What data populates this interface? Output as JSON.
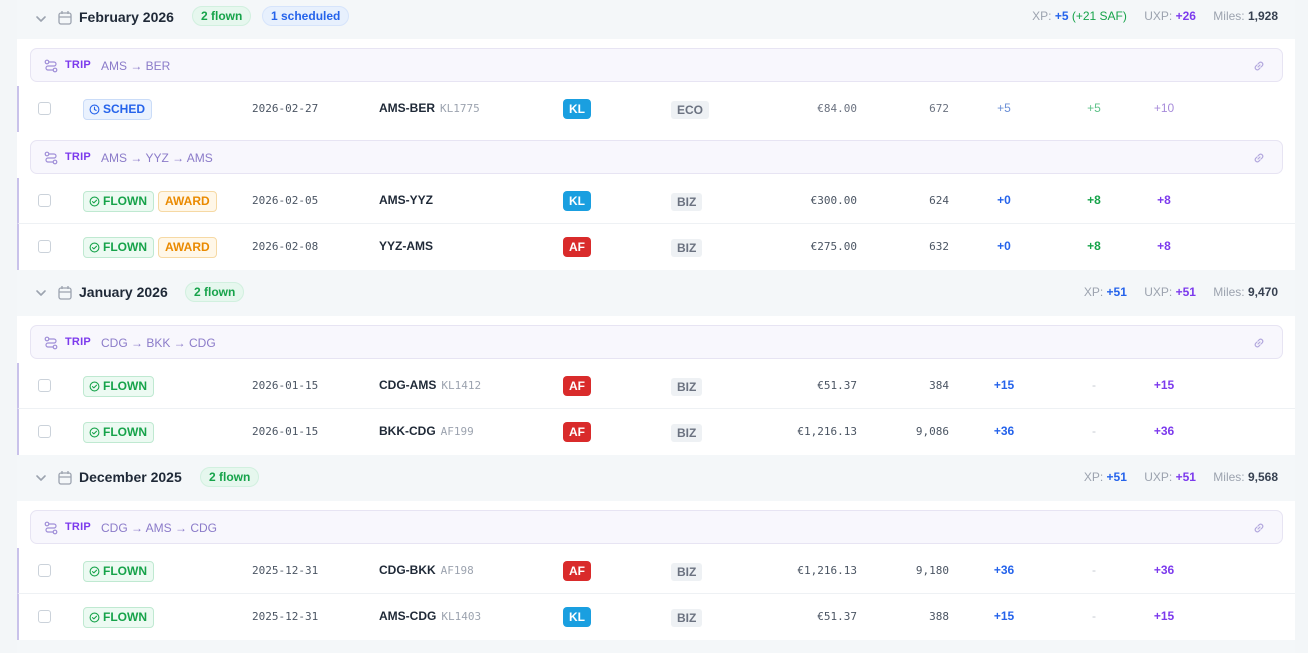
{
  "months": [
    {
      "title": "February 2026",
      "flown_badge": "2 flown",
      "scheduled_badge": "1 scheduled",
      "stats": {
        "xp_label": "XP:",
        "xp": "+5",
        "saf": "(+21 SAF)",
        "uxp_label": "UXP:",
        "uxp": "+26",
        "miles_label": "Miles:",
        "miles": "1,928"
      },
      "trips": [
        {
          "tag": "TRIP",
          "route": "AMS → BER",
          "flights": [
            {
              "status": "SCHED",
              "award": "",
              "date": "2026-02-27",
              "route": "AMS-BER",
              "flight_no": "KL1775",
              "airline": "KL",
              "cabin": "ECO",
              "price": "€84.00",
              "miles": "672",
              "xp": "+5",
              "saf": "+5",
              "uxp": "+10"
            }
          ]
        },
        {
          "tag": "TRIP",
          "route": "AMS → YYZ → AMS",
          "flights": [
            {
              "status": "FLOWN",
              "award": "AWARD",
              "date": "2026-02-05",
              "route": "AMS-YYZ",
              "flight_no": "",
              "airline": "KL",
              "cabin": "BIZ",
              "price": "€300.00",
              "miles": "624",
              "xp": "+0",
              "saf": "+8",
              "uxp": "+8"
            },
            {
              "status": "FLOWN",
              "award": "AWARD",
              "date": "2026-02-08",
              "route": "YYZ-AMS",
              "flight_no": "",
              "airline": "AF",
              "cabin": "BIZ",
              "price": "€275.00",
              "miles": "632",
              "xp": "+0",
              "saf": "+8",
              "uxp": "+8"
            }
          ]
        }
      ]
    },
    {
      "title": "January 2026",
      "flown_badge": "2 flown",
      "stats": {
        "xp_label": "XP:",
        "xp": "+51",
        "uxp_label": "UXP:",
        "uxp": "+51",
        "miles_label": "Miles:",
        "miles": "9,470"
      },
      "trips": [
        {
          "tag": "TRIP",
          "route": "CDG → BKK → CDG",
          "flights": [
            {
              "status": "FLOWN",
              "date": "2026-01-15",
              "route": "CDG-AMS",
              "flight_no": "KL1412",
              "airline": "AF",
              "cabin": "BIZ",
              "price": "€51.37",
              "miles": "384",
              "xp": "+15",
              "saf": "-",
              "uxp": "+15"
            },
            {
              "status": "FLOWN",
              "date": "2026-01-15",
              "route": "BKK-CDG",
              "flight_no": "AF199",
              "airline": "AF",
              "cabin": "BIZ",
              "price": "€1,216.13",
              "miles": "9,086",
              "xp": "+36",
              "saf": "-",
              "uxp": "+36"
            }
          ]
        }
      ]
    },
    {
      "title": "December 2025",
      "flown_badge": "2 flown",
      "stats": {
        "xp_label": "XP:",
        "xp": "+51",
        "uxp_label": "UXP:",
        "uxp": "+51",
        "miles_label": "Miles:",
        "miles": "9,568"
      },
      "trips": [
        {
          "tag": "TRIP",
          "route": "CDG → AMS → CDG",
          "flights": [
            {
              "status": "FLOWN",
              "date": "2025-12-31",
              "route": "CDG-BKK",
              "flight_no": "AF198",
              "airline": "AF",
              "cabin": "BIZ",
              "price": "€1,216.13",
              "miles": "9,180",
              "xp": "+36",
              "saf": "-",
              "uxp": "+36"
            },
            {
              "status": "FLOWN",
              "date": "2025-12-31",
              "route": "AMS-CDG",
              "flight_no": "KL1403",
              "airline": "KL",
              "cabin": "BIZ",
              "price": "€51.37",
              "miles": "388",
              "xp": "+15",
              "saf": "-",
              "uxp": "+15"
            }
          ]
        }
      ]
    }
  ],
  "colors": {
    "kl": "#1a9fe0",
    "af": "#d92b2b",
    "trip_accent": "#7c3aed",
    "xp": "#2563eb",
    "saf": "#16a34a",
    "uxp": "#7c3aed"
  },
  "icons": {
    "chevron": "chevron-down-icon",
    "calendar": "calendar-icon",
    "trip": "route-icon",
    "link": "link-icon",
    "check": "check-circle-icon",
    "clock": "clock-icon"
  }
}
